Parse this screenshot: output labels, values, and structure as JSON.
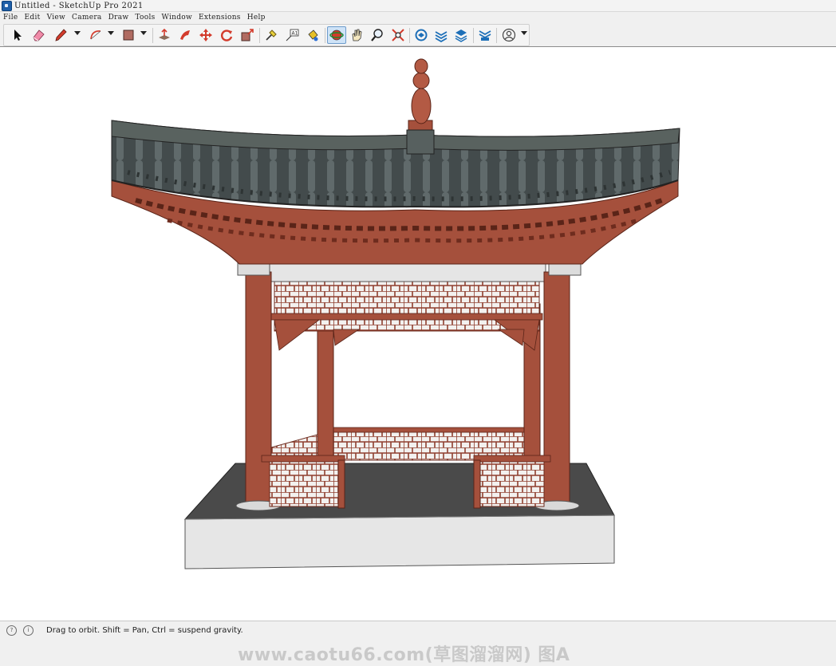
{
  "window": {
    "title": "Untitled - SketchUp Pro 2021"
  },
  "menu": {
    "items": [
      "File",
      "Edit",
      "View",
      "Camera",
      "Draw",
      "Tools",
      "Window",
      "Extensions",
      "Help"
    ]
  },
  "toolbar": {
    "tools": [
      {
        "icon": "select-arrow-icon"
      },
      {
        "icon": "eraser-icon"
      },
      {
        "icon": "pencil-line-icon"
      },
      {
        "icon": "arc-icon"
      },
      {
        "icon": "rectangle-shape-icon"
      },
      {
        "icon": "push-pull-icon"
      },
      {
        "icon": "follow-me-icon"
      },
      {
        "icon": "move-icon"
      },
      {
        "icon": "rotate-icon"
      },
      {
        "icon": "scale-icon"
      },
      {
        "icon": "tape-measure-icon"
      },
      {
        "icon": "text-icon"
      },
      {
        "icon": "paint-bucket-icon"
      },
      {
        "icon": "orbit-icon"
      },
      {
        "icon": "pan-icon"
      },
      {
        "icon": "zoom-icon"
      },
      {
        "icon": "zoom-extents-icon"
      },
      {
        "icon": "3d-warehouse-icon"
      },
      {
        "icon": "extension-warehouse-icon"
      },
      {
        "icon": "layout-icon"
      },
      {
        "icon": "extension-manager-icon"
      },
      {
        "icon": "account-icon"
      }
    ],
    "active_tool": "orbit-icon",
    "accent": "#1d6fb8"
  },
  "status": {
    "text": "Drag to orbit. Shift = Pan, Ctrl = suspend gravity."
  },
  "watermark": {
    "text": "www.caotu66.com(草图溜溜网) 图A"
  },
  "colors": {
    "roof": "#4f5859",
    "timber": "#a5503c",
    "base": "#e6e6e6",
    "floor": "#4a4a4a"
  }
}
